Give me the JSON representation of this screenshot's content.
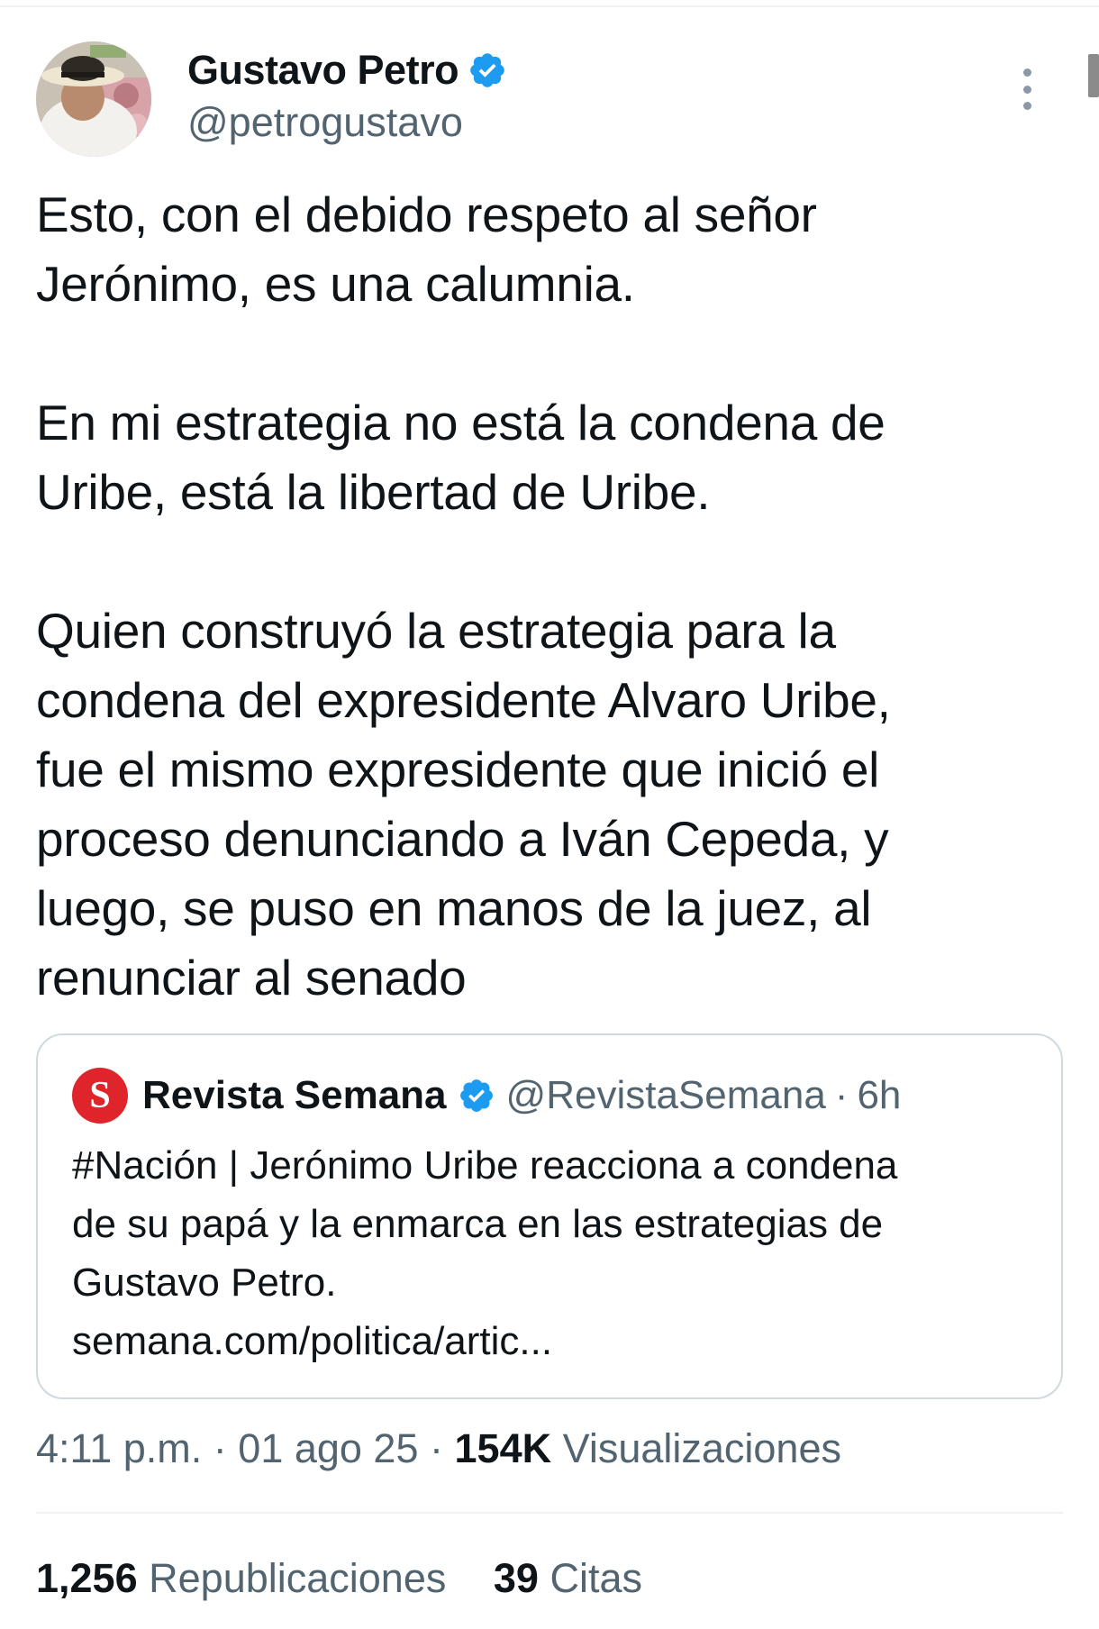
{
  "tweet": {
    "author": {
      "name": "Gustavo Petro",
      "handle": "@petrogustavo",
      "verified": true,
      "avatar_icon": "profile-photo-icon"
    },
    "text_lines": [
      "Esto, con el debido respeto al señor",
      "Jerónimo, es una calumnia.",
      "",
      "En mi estrategia no está la condena de",
      "Uribe, está la libertad de Uribe.",
      "",
      "Quien construyó la estrategia para la",
      "condena del expresidente Alvaro Uribe,",
      "fue el mismo expresidente que inició el",
      "proceso denunciando a Iván Cepeda, y",
      "luego, se puso en manos de la juez, al",
      "renunciar al senado"
    ],
    "quote": {
      "logo_letter": "S",
      "name": "Revista Semana",
      "handle": "@RevistaSemana",
      "separator": "·",
      "time": "6h",
      "text_lines": [
        "#Nación | Jerónimo Uribe reacciona a condena",
        "de su papá y la enmarca en las estrategias de",
        "Gustavo Petro.",
        "semana.com/politica/artic..."
      ]
    },
    "meta": {
      "time": "4:11 p.m.",
      "separator": "·",
      "date": "01 ago 25",
      "views_count": "154K",
      "views_label": "Visualizaciones"
    },
    "stats": {
      "reposts_count": "1,256",
      "reposts_label": "Republicaciones",
      "quotes_count": "39",
      "quotes_label": "Citas"
    }
  },
  "colors": {
    "text_primary": "#0f1419",
    "text_secondary": "#536471",
    "verified_blue": "#1d9bf0",
    "quote_logo_red": "#e0242b",
    "border": "#cfd9de"
  }
}
